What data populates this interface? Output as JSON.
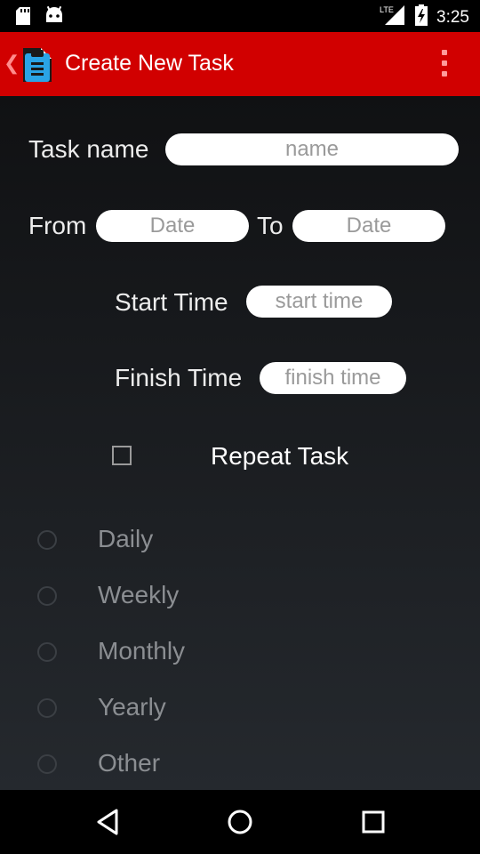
{
  "status_bar": {
    "time": "3:25",
    "network": "LTE",
    "icons": [
      "sd-card-icon",
      "android-icon",
      "signal-icon",
      "battery-charging-icon"
    ]
  },
  "app_bar": {
    "title": "Create New Task",
    "color": "#d10000",
    "icons": [
      "back-chevron-icon",
      "clipboard-icon",
      "overflow-menu-icon"
    ]
  },
  "form": {
    "task_name_label": "Task name",
    "task_name_placeholder": "name",
    "from_label": "From",
    "from_placeholder": "Date",
    "to_label": "To",
    "to_placeholder": "Date",
    "start_time_label": "Start Time",
    "start_time_placeholder": "start time",
    "finish_time_label": "Finish Time",
    "finish_time_placeholder": "finish time",
    "repeat_label": "Repeat Task",
    "repeat_checked": false
  },
  "repeat_options": [
    {
      "label": "Daily",
      "selected": false
    },
    {
      "label": "Weekly",
      "selected": false
    },
    {
      "label": "Monthly",
      "selected": false
    },
    {
      "label": "Yearly",
      "selected": false
    },
    {
      "label": "Other",
      "selected": false
    }
  ],
  "nav_bar": {
    "icons": [
      "back-icon",
      "home-icon",
      "recents-icon"
    ]
  }
}
